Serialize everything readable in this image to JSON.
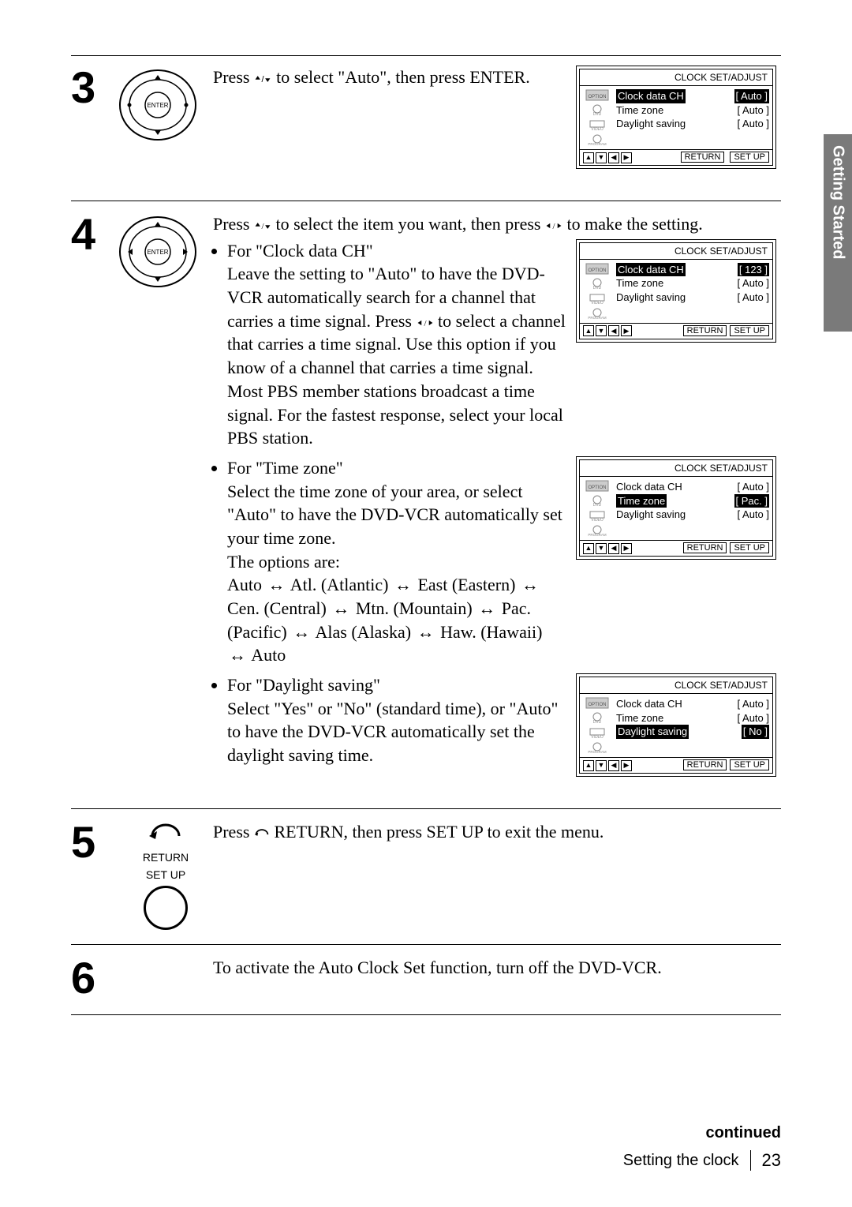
{
  "sideTab": "Getting Started",
  "steps": {
    "s3": {
      "num": "3",
      "text_a": "Press ",
      "text_b": " to select \"Auto\", then press ENTER.",
      "enter": "ENTER"
    },
    "s4": {
      "num": "4",
      "intro_a": "Press ",
      "intro_b": " to select the item you want, then press ",
      "intro_c": " to make the setting.",
      "enter": "ENTER",
      "b1": {
        "head": "For \"Clock data CH\"",
        "body_a": "Leave the setting to \"Auto\" to have the DVD-VCR automatically search for a channel that carries a time signal.  Press ",
        "body_b": " to select a channel that carries a time signal.  Use this option if you know of a channel that carries a time signal.  Most PBS member stations broadcast a time signal.  For the fastest response, select your local PBS station."
      },
      "b2": {
        "head": "For \"Time zone\"",
        "body1": "Select the time zone of your area, or select \"Auto\" to have the DVD-VCR automatically set your time zone.",
        "body2": "The options are:",
        "tz_auto": "Auto",
        "tz_atl": "Atl. (Atlantic)",
        "tz_east": "East (Eastern)",
        "tz_cen": "Cen. (Central)",
        "tz_mtn": "Mtn. (Mountain)",
        "tz_pac": "Pac. (Pacific)",
        "tz_alas": "Alas (Alaska)",
        "tz_haw": "Haw. (Hawaii)",
        "tz_auto2": "Auto"
      },
      "b3": {
        "head": "For \"Daylight saving\"",
        "body": "Select \"Yes\" or \"No\" (standard time), or \"Auto\" to have the DVD-VCR automatically set the daylight saving time."
      }
    },
    "s5": {
      "num": "5",
      "text_a": "Press ",
      "text_b": " RETURN, then press SET UP to exit the menu.",
      "return": "RETURN",
      "setup": "SET UP"
    },
    "s6": {
      "num": "6",
      "text": "To activate the Auto Clock Set function, turn off the DVD-VCR."
    }
  },
  "screens": {
    "title": "CLOCK SET/ADJUST",
    "labels": {
      "cdc": "Clock data CH",
      "tz": "Time zone",
      "ds": "Daylight saving"
    },
    "side": {
      "option": "OPTION",
      "dvd": "DVD",
      "video": "VIDEO",
      "program": "PROGRAM"
    },
    "footer": {
      "return": "RETURN",
      "setup": "SET UP"
    },
    "sc1": {
      "cdc": "[  Auto  ]",
      "tz": "[  Auto  ]",
      "ds": "[  Auto  ]",
      "hl": "cdc"
    },
    "sc2": {
      "cdc": "[   123  ]",
      "tz": "[  Auto  ]",
      "ds": "[  Auto  ]",
      "hl": "cdc"
    },
    "sc3": {
      "cdc": "[  Auto  ]",
      "tz": "[  Pac.  ]",
      "ds": "[  Auto  ]",
      "hl": "tz"
    },
    "sc4": {
      "cdc": "[  Auto  ]",
      "tz": "[  Auto  ]",
      "ds": "[   No   ]",
      "hl": "ds"
    }
  },
  "footer": {
    "continued": "continued",
    "section": "Setting the clock",
    "page": "23"
  },
  "glyphs": {
    "updown": "♦/♦",
    "leftright": "♦/♦"
  }
}
